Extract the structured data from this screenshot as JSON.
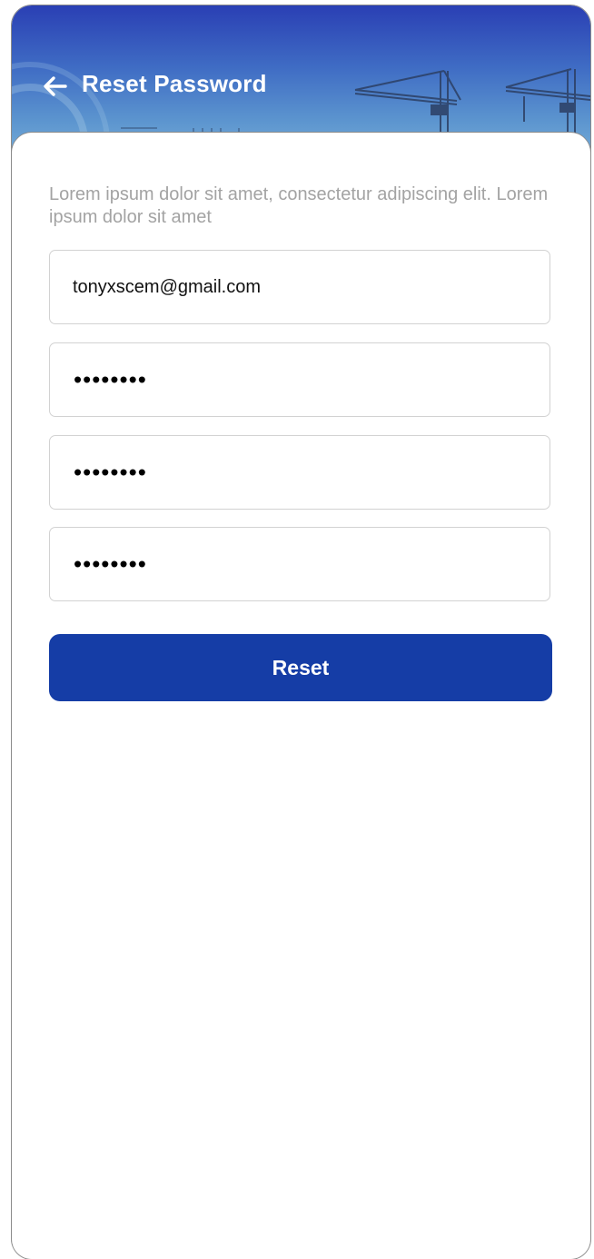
{
  "header": {
    "title": "Reset Password",
    "back_icon": "arrow-left-icon"
  },
  "form": {
    "description": "Lorem ipsum dolor sit amet, consectetur adipiscing elit. Lorem ipsum dolor sit amet",
    "email_value": "tonyxscem@gmail.com",
    "password_1_mask": "••••••••",
    "password_2_mask": "••••••••",
    "password_3_mask": "••••••••",
    "submit_label": "Reset"
  },
  "colors": {
    "header_top": "#2a3fb4",
    "header_bottom": "#78aed8",
    "button": "#153da6",
    "description_text": "#a3a3a3",
    "field_border": "#d2d2d2"
  }
}
